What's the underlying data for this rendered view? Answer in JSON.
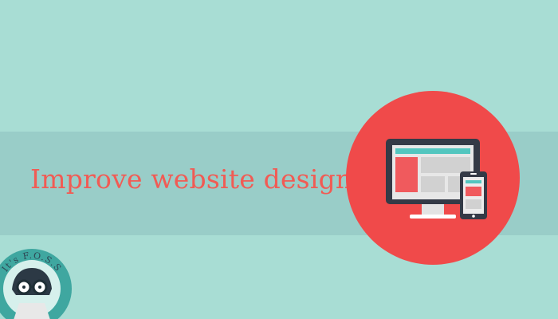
{
  "headline": "Improve website design",
  "badge": {
    "text": "It's F.O.S.S"
  },
  "colors": {
    "background": "#a8ddd4",
    "band": "#99cdc8",
    "accent_red": "#f04a4a",
    "headline_red": "#f15b54",
    "device_dark": "#343a46",
    "badge_teal": "#3fa7a0"
  },
  "icons": {
    "main": "responsive-devices-icon",
    "badge": "its-foss-logo-icon"
  }
}
